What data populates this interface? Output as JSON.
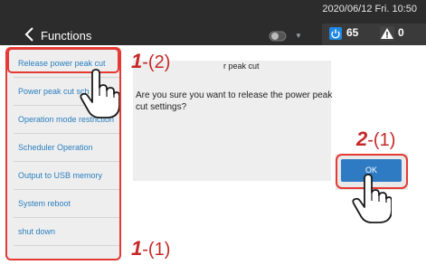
{
  "header": {
    "title": "Functions",
    "datetime": "2020/06/12 Fri. 10:50",
    "power_count": "65",
    "warning_count": "0"
  },
  "sidebar": {
    "items": [
      {
        "label": "Release power peak cut",
        "selected": true
      },
      {
        "label": "Power peak cut sch"
      },
      {
        "label": "Operation mode restriction"
      },
      {
        "label": "Scheduler Operation"
      },
      {
        "label": "Output to USB memory"
      },
      {
        "label": "System reboot"
      },
      {
        "label": "shut down"
      }
    ]
  },
  "dialog": {
    "title": "r peak cut",
    "message": "Are you sure you want to release the power peak cut settings?",
    "ok_label": "OK"
  },
  "annotations": {
    "step1_num": "1",
    "step1_sub2": "(2)",
    "step1_sub1": "(1)",
    "step2_num": "2",
    "step2_sub1": "(1)"
  },
  "colors": {
    "header": "#2c2c2c",
    "accent_blue": "#2e7bc4",
    "annotation_red": "#c62828"
  },
  "icons": {
    "back": "chevron-left-icon",
    "toggle": "toggle-icon",
    "power": "power-icon",
    "warning": "warning-icon",
    "pointer": "hand-pointer-icon"
  }
}
